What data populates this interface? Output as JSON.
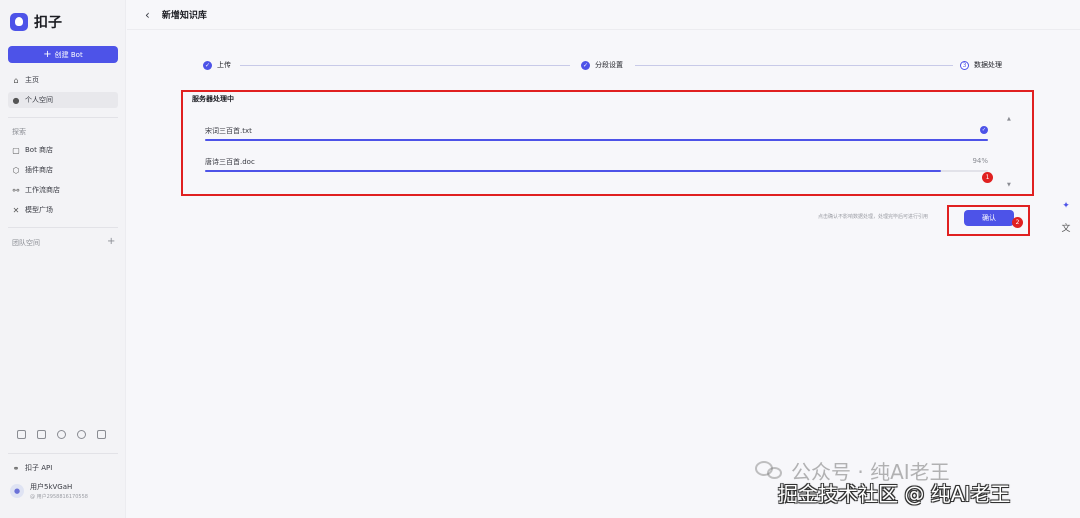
{
  "app": {
    "name": "扣子"
  },
  "sidebar": {
    "create_label": "创建 Bot",
    "items": [
      {
        "label": "主页",
        "icon": "home-icon"
      },
      {
        "label": "个人空间",
        "icon": "user-icon"
      }
    ],
    "explore_title": "探索",
    "explore_items": [
      {
        "label": "Bot 商店",
        "icon": "bot-icon"
      },
      {
        "label": "插件商店",
        "icon": "plugin-icon"
      },
      {
        "label": "工作流商店",
        "icon": "workflow-icon"
      },
      {
        "label": "模型广场",
        "icon": "model-icon"
      }
    ],
    "team_title": "团队空间",
    "api_label": "扣子 API",
    "user": {
      "name": "用户5kVGaH",
      "id": "@ 用户2958816170558"
    }
  },
  "header": {
    "title": "新增知识库"
  },
  "steps": [
    {
      "label": "上传",
      "status": "done"
    },
    {
      "label": "分段设置",
      "status": "done"
    },
    {
      "label": "数据处理",
      "status": "current",
      "number": "3"
    }
  ],
  "processing": {
    "title": "服务器处理中",
    "files": [
      {
        "name": "宋词三百首.txt",
        "progress": 1.0,
        "progress_label": ""
      },
      {
        "name": "唐诗三百首.doc",
        "progress": 0.94,
        "progress_label": "94%"
      }
    ]
  },
  "annotations": {
    "badge1": "1",
    "badge2": "2"
  },
  "footer": {
    "hint": "点击确认不影响数据处理，处理完毕后可进行引用",
    "confirm_label": "确认"
  },
  "watermark": {
    "line1": "公众号 · 纯AI老王",
    "line2": "掘金技术社区 @ 纯AI老王"
  },
  "colors": {
    "accent": "#4d53e8",
    "annotation": "#e02020"
  }
}
